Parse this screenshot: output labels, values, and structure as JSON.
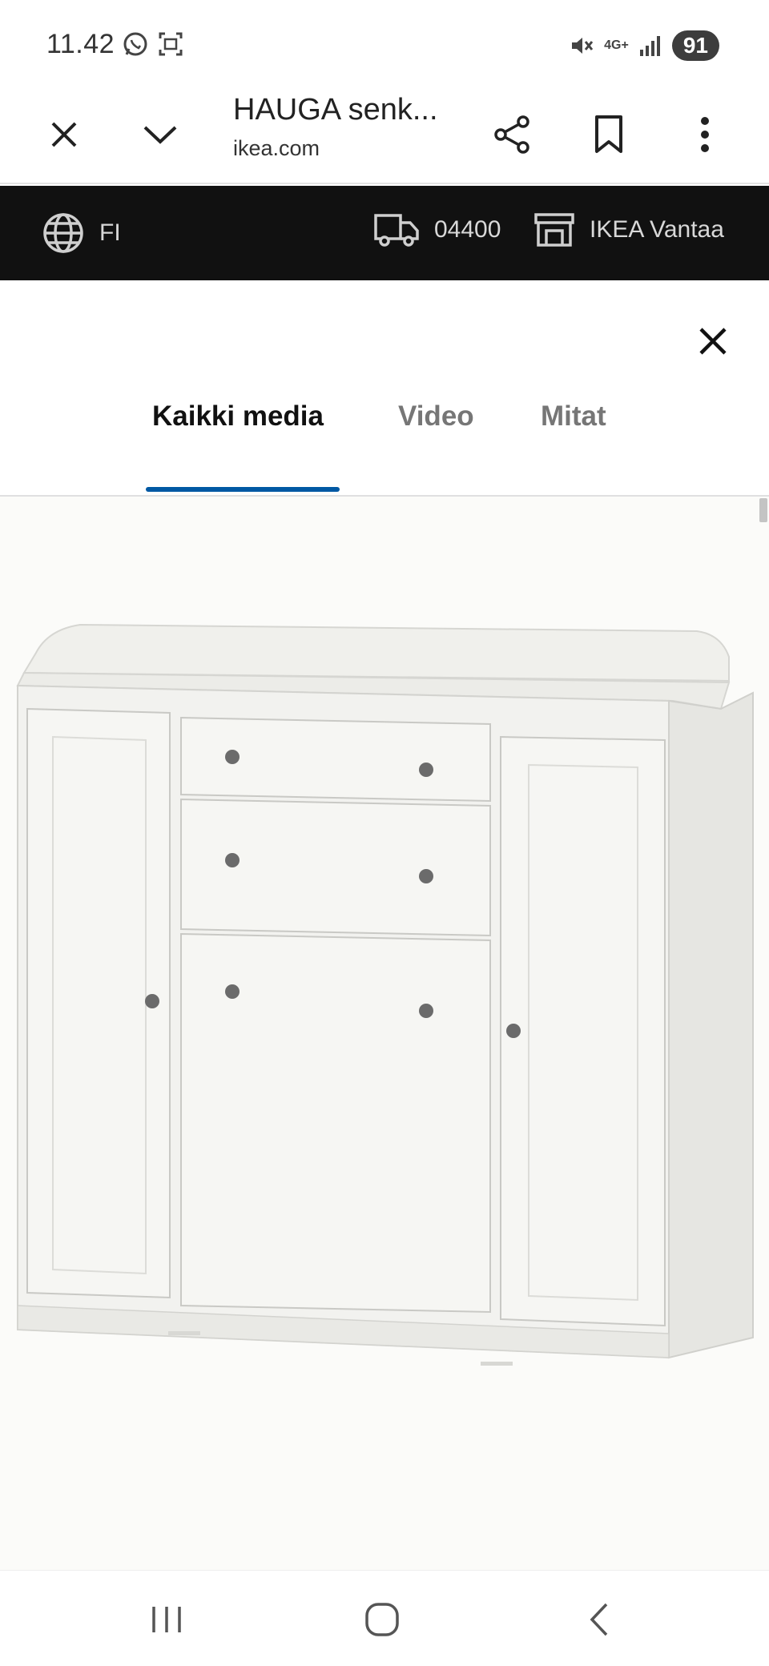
{
  "status_bar": {
    "time": "11.42",
    "network_label": "4G+",
    "battery": "91"
  },
  "browser": {
    "title": "HAUGA senk...",
    "url": "ikea.com"
  },
  "ikea_bar": {
    "language": "FI",
    "postal_code": "04400",
    "store": "IKEA Vantaa"
  },
  "tabs": [
    {
      "label": "Kaikki media",
      "active": true
    },
    {
      "label": "Video",
      "active": false
    },
    {
      "label": "Mitat",
      "active": false
    }
  ],
  "media": {
    "image_description": "product-photo-sideboard"
  },
  "colors": {
    "accent": "#0058a3",
    "ikea_bar_bg": "#111111"
  },
  "icons": {
    "close": "close-icon",
    "collapse": "chevron-down-icon",
    "share": "share-icon",
    "bookmark": "bookmark-icon",
    "menu": "more-vert-icon",
    "globe": "globe-icon",
    "delivery": "truck-icon",
    "store": "store-icon"
  }
}
